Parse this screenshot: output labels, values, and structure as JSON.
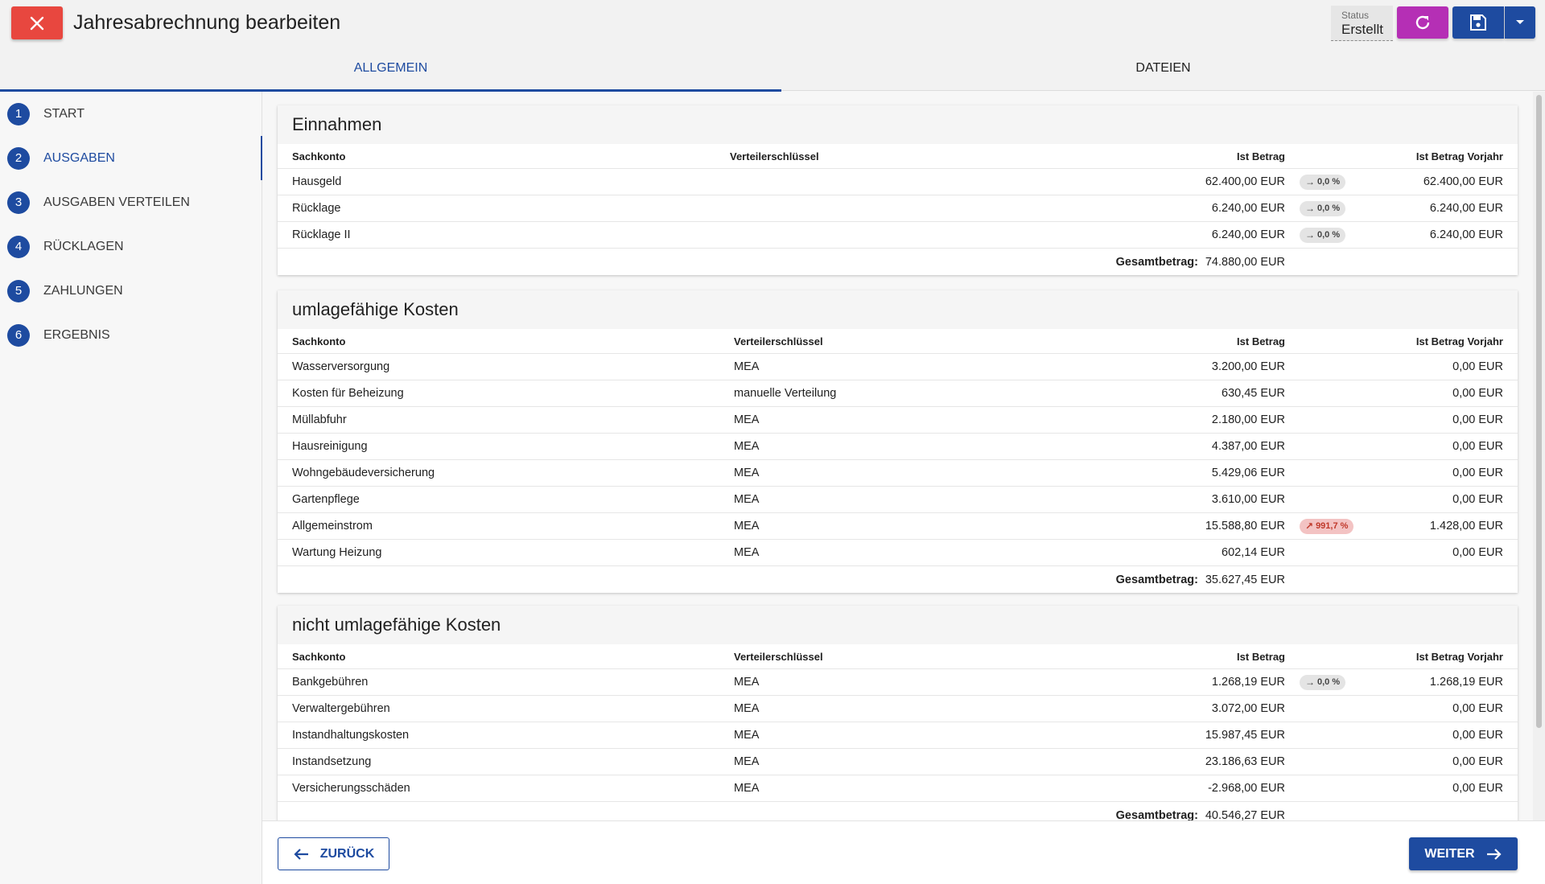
{
  "header": {
    "title": "Jahresabrechnung bearbeiten",
    "status_label": "Status",
    "status_value": "Erstellt",
    "close_icon": "close-icon",
    "refresh_icon": "refresh-icon",
    "save_icon": "save-icon",
    "dropdown_icon": "caret-down-icon"
  },
  "tabs": [
    {
      "label": "ALLGEMEIN",
      "active": true
    },
    {
      "label": "DATEIEN",
      "active": false
    }
  ],
  "steps": [
    {
      "num": "1",
      "label": "START"
    },
    {
      "num": "2",
      "label": "AUSGABEN",
      "active": true
    },
    {
      "num": "3",
      "label": "AUSGABEN VERTEILEN"
    },
    {
      "num": "4",
      "label": "RÜCKLAGEN"
    },
    {
      "num": "5",
      "label": "ZAHLUNGEN"
    },
    {
      "num": "6",
      "label": "ERGEBNIS"
    }
  ],
  "sections": [
    {
      "title": "Einnahmen",
      "headers": {
        "konto": "Sachkonto",
        "schluessel": "Verteilerschlüssel",
        "ist": "Ist Betrag",
        "vorjahr": "Ist Betrag Vorjahr"
      },
      "rows": [
        {
          "konto": "Hausgeld",
          "schluessel": "",
          "ist": "62.400,00 EUR",
          "badge": "0,0 %",
          "trend": "flat",
          "vorjahr": "62.400,00 EUR"
        },
        {
          "konto": "Rücklage",
          "schluessel": "",
          "ist": "6.240,00 EUR",
          "badge": "0,0 %",
          "trend": "flat",
          "vorjahr": "6.240,00 EUR"
        },
        {
          "konto": "Rücklage II",
          "schluessel": "",
          "ist": "6.240,00 EUR",
          "badge": "0,0 %",
          "trend": "flat",
          "vorjahr": "6.240,00 EUR"
        }
      ],
      "total_label": "Gesamtbetrag:",
      "total": "74.880,00 EUR"
    },
    {
      "title": "umlagefähige Kosten",
      "headers": {
        "konto": "Sachkonto",
        "schluessel": "Verteilerschlüssel",
        "ist": "Ist Betrag",
        "vorjahr": "Ist Betrag Vorjahr"
      },
      "rows": [
        {
          "konto": "Wasserversorgung",
          "schluessel": "MEA",
          "ist": "3.200,00 EUR",
          "badge": "",
          "trend": "",
          "vorjahr": "0,00 EUR"
        },
        {
          "konto": "Kosten für Beheizung",
          "schluessel": "manuelle Verteilung",
          "ist": "630,45 EUR",
          "badge": "",
          "trend": "",
          "vorjahr": "0,00 EUR"
        },
        {
          "konto": "Müllabfuhr",
          "schluessel": "MEA",
          "ist": "2.180,00 EUR",
          "badge": "",
          "trend": "",
          "vorjahr": "0,00 EUR"
        },
        {
          "konto": "Hausreinigung",
          "schluessel": "MEA",
          "ist": "4.387,00 EUR",
          "badge": "",
          "trend": "",
          "vorjahr": "0,00 EUR"
        },
        {
          "konto": "Wohngebäudeversicherung",
          "schluessel": "MEA",
          "ist": "5.429,06 EUR",
          "badge": "",
          "trend": "",
          "vorjahr": "0,00 EUR"
        },
        {
          "konto": "Gartenpflege",
          "schluessel": "MEA",
          "ist": "3.610,00 EUR",
          "badge": "",
          "trend": "",
          "vorjahr": "0,00 EUR"
        },
        {
          "konto": "Allgemeinstrom",
          "schluessel": "MEA",
          "ist": "15.588,80 EUR",
          "badge": "991,7 %",
          "trend": "up",
          "vorjahr": "1.428,00 EUR"
        },
        {
          "konto": "Wartung Heizung",
          "schluessel": "MEA",
          "ist": "602,14 EUR",
          "badge": "",
          "trend": "",
          "vorjahr": "0,00 EUR"
        }
      ],
      "total_label": "Gesamtbetrag:",
      "total": "35.627,45 EUR"
    },
    {
      "title": "nicht umlagefähige Kosten",
      "headers": {
        "konto": "Sachkonto",
        "schluessel": "Verteilerschlüssel",
        "ist": "Ist Betrag",
        "vorjahr": "Ist Betrag Vorjahr"
      },
      "rows": [
        {
          "konto": "Bankgebühren",
          "schluessel": "MEA",
          "ist": "1.268,19 EUR",
          "badge": "0,0 %",
          "trend": "flat",
          "vorjahr": "1.268,19 EUR"
        },
        {
          "konto": "Verwaltergebühren",
          "schluessel": "MEA",
          "ist": "3.072,00 EUR",
          "badge": "",
          "trend": "",
          "vorjahr": "0,00 EUR"
        },
        {
          "konto": "Instandhaltungskosten",
          "schluessel": "MEA",
          "ist": "15.987,45 EUR",
          "badge": "",
          "trend": "",
          "vorjahr": "0,00 EUR"
        },
        {
          "konto": "Instandsetzung",
          "schluessel": "MEA",
          "ist": "23.186,63 EUR",
          "badge": "",
          "trend": "",
          "vorjahr": "0,00 EUR"
        },
        {
          "konto": "Versicherungsschäden",
          "schluessel": "MEA",
          "ist": "-2.968,00 EUR",
          "badge": "",
          "trend": "",
          "vorjahr": "0,00 EUR"
        }
      ],
      "total_label": "Gesamtbetrag:",
      "total": "40.546,27 EUR"
    }
  ],
  "footer": {
    "back_label": "ZURÜCK",
    "next_label": "WEITER"
  },
  "colors": {
    "primary": "#1e4ba0",
    "close": "#e8473f",
    "refresh": "#b52fb5",
    "badge_up_bg": "#f3c3c3",
    "badge_up_text": "#c0392b"
  }
}
